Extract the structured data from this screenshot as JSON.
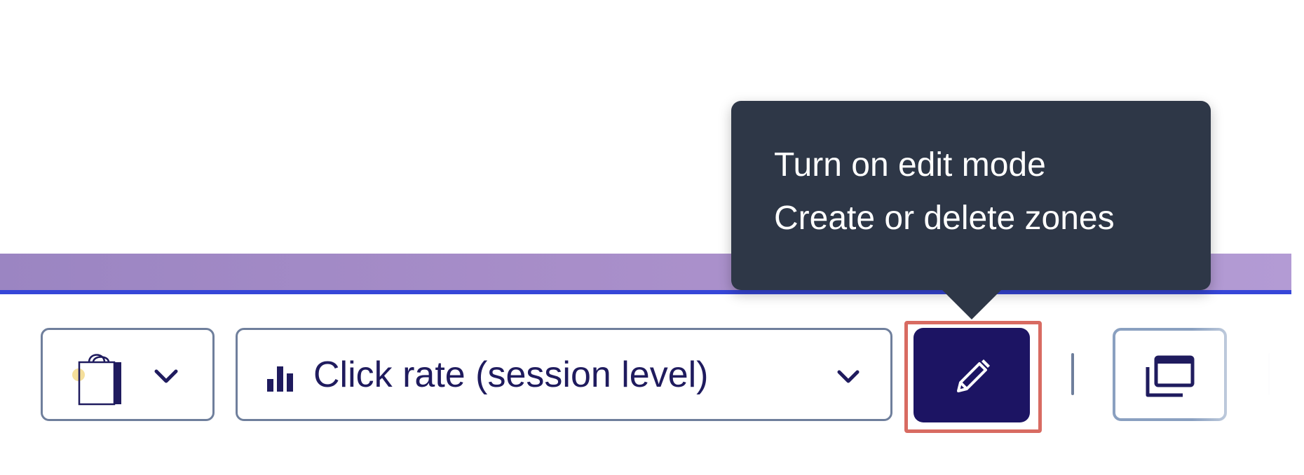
{
  "tooltip": {
    "line1": "Turn on edit mode",
    "line2": "Create or delete zones"
  },
  "toolbar": {
    "bag_select": {
      "icon": "shopping-bag-icon",
      "chevron": "chevron-down-icon"
    },
    "metric_select": {
      "icon": "bar-chart-icon",
      "label": "Click rate (session level)",
      "chevron": "chevron-down-icon"
    },
    "edit_button": {
      "icon": "pencil-icon",
      "highlighted": true
    },
    "copy_button": {
      "icon": "copy-windows-icon"
    }
  },
  "colors": {
    "tooltip_bg": "#2e3747",
    "accent_navy": "#1c1463",
    "text_navy": "#1f1b5e",
    "border_gray_blue": "#6f7f9c",
    "highlight_red": "#d86b62",
    "purple_band": "#a88ec9",
    "blue_line": "#3646d8"
  }
}
